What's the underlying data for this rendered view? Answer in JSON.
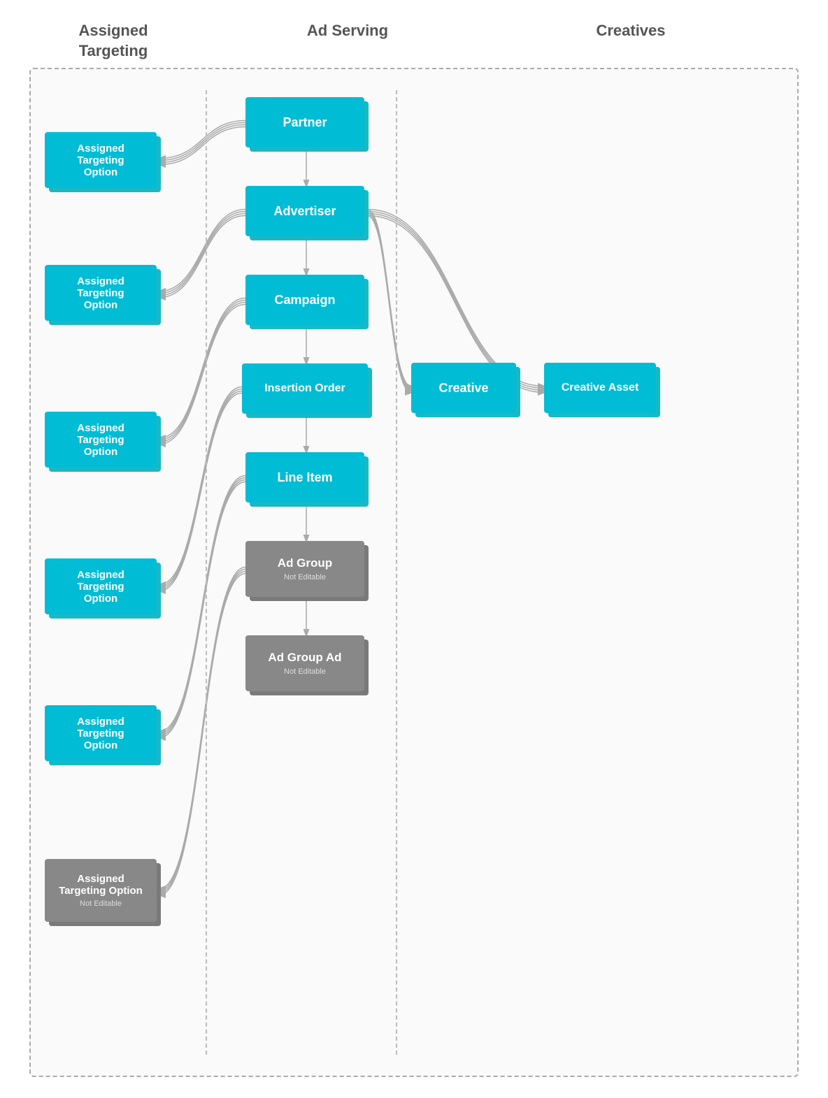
{
  "headers": {
    "assigned": "Assigned\nTargeting",
    "adserving": "Ad Serving",
    "creatives": "Creatives"
  },
  "adserving_nodes": [
    {
      "id": "partner",
      "label": "Partner",
      "type": "teal"
    },
    {
      "id": "advertiser",
      "label": "Advertiser",
      "type": "teal"
    },
    {
      "id": "campaign",
      "label": "Campaign",
      "type": "teal"
    },
    {
      "id": "insertion_order",
      "label": "Insertion Order",
      "type": "teal"
    },
    {
      "id": "line_item",
      "label": "Line Item",
      "type": "teal"
    },
    {
      "id": "ad_group",
      "label": "Ad Group",
      "type": "gray",
      "sub": "Not Editable"
    },
    {
      "id": "ad_group_ad",
      "label": "Ad Group Ad",
      "type": "gray",
      "sub": "Not Editable"
    }
  ],
  "assigned_nodes": [
    {
      "id": "ato1",
      "label": "Assigned\nTargeting\nOption",
      "type": "teal"
    },
    {
      "id": "ato2",
      "label": "Assigned\nTargeting\nOption",
      "type": "teal"
    },
    {
      "id": "ato3",
      "label": "Assigned\nTargeting\nOption",
      "type": "teal"
    },
    {
      "id": "ato4",
      "label": "Assigned\nTargeting\nOption",
      "type": "teal"
    },
    {
      "id": "ato5",
      "label": "Assigned\nTargeting\nOption",
      "type": "teal"
    },
    {
      "id": "ato6",
      "label": "Assigned\nTargeting\nOption",
      "type": "gray",
      "sub": "Not Editable"
    }
  ],
  "creative_nodes": [
    {
      "id": "creative",
      "label": "Creative",
      "type": "teal"
    },
    {
      "id": "creative_asset",
      "label": "Creative Asset",
      "type": "teal"
    }
  ],
  "colors": {
    "teal_main": "#00bcd4",
    "teal_shadow": "#1ab8c4",
    "gray_main": "#888888",
    "gray_shadow": "#7a7a7a",
    "border_dashed": "#aaaaaa",
    "arrow_color": "#aaaaaa"
  }
}
